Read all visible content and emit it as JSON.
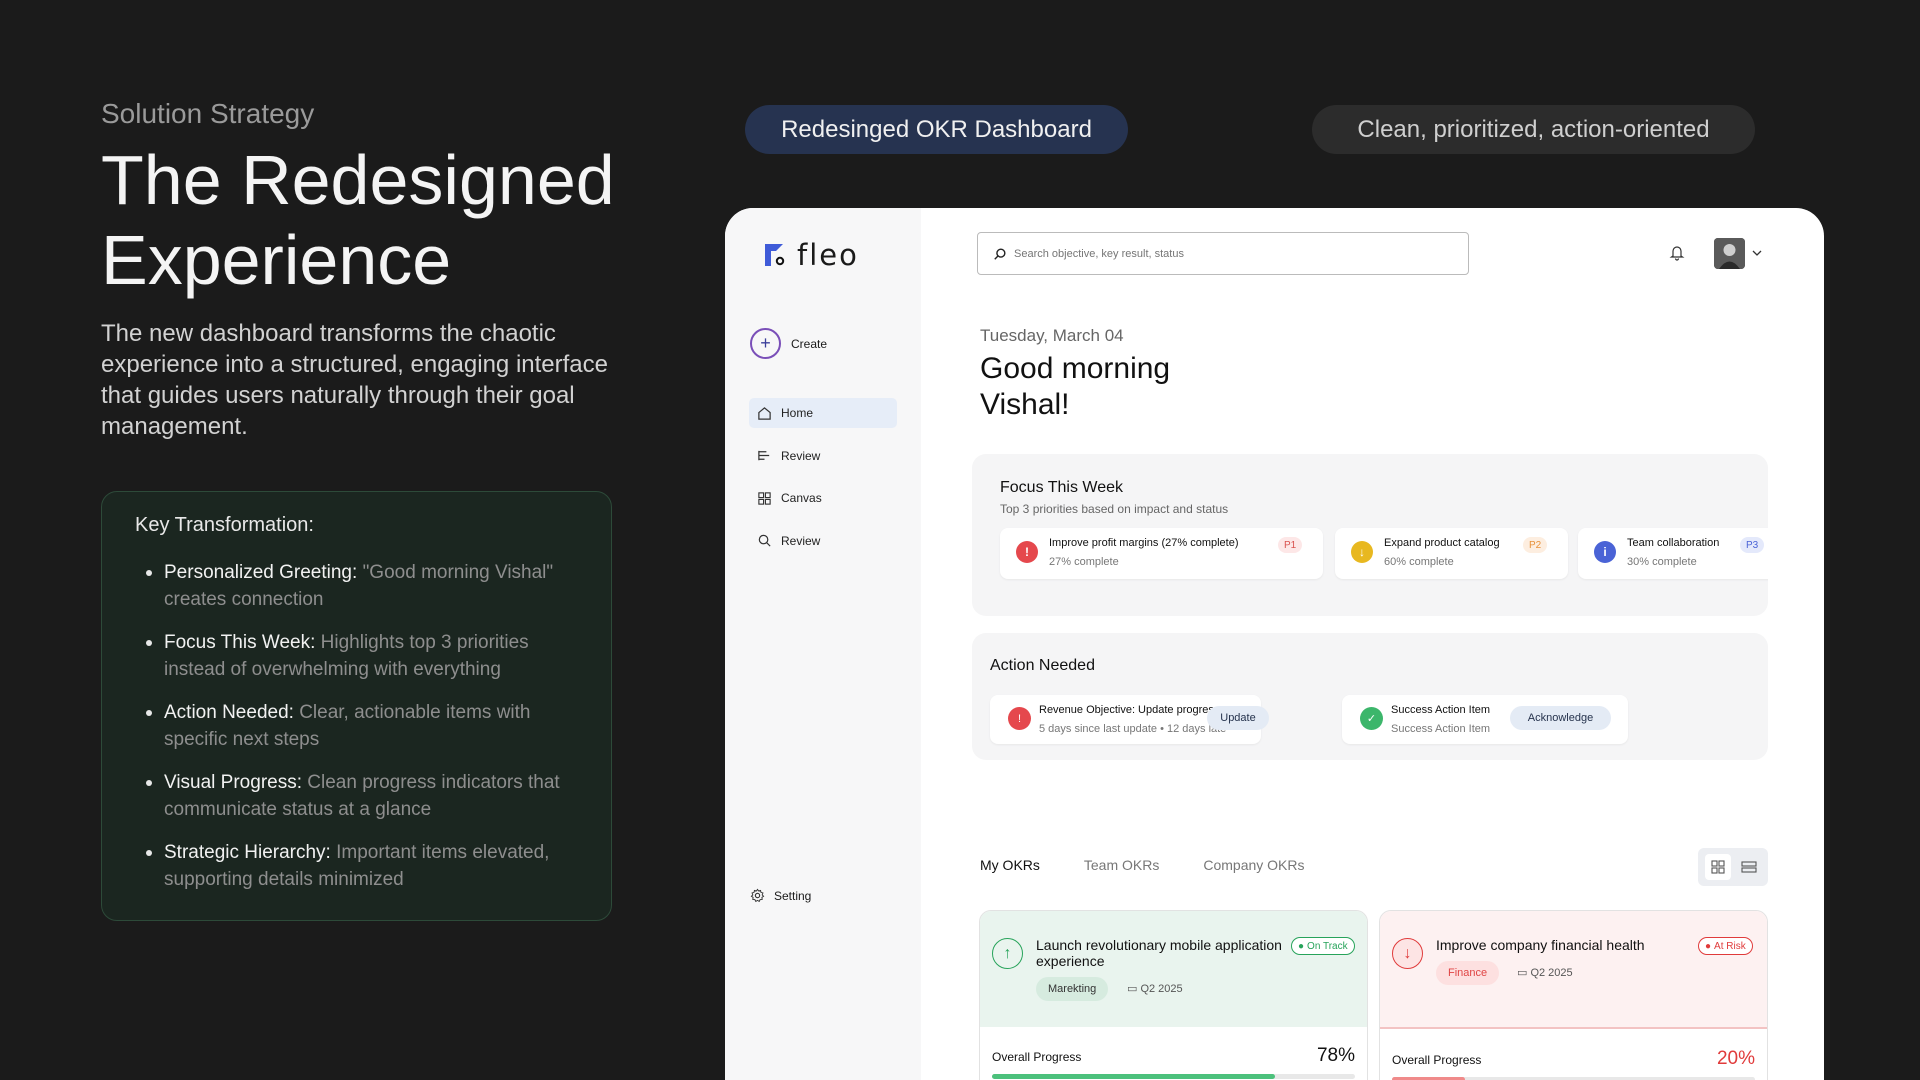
{
  "slide": {
    "eyebrow": "Solution Strategy",
    "headline": "The Redesigned Experience",
    "lede": "The new dashboard transforms the chaotic experience into a structured, engaging interface that guides users naturally through their goal management.",
    "key_box": {
      "title": "Key Transformation:",
      "items": [
        {
          "term": "Personalized Greeting:",
          "desc": "\"Good morning Vishal\" creates connection"
        },
        {
          "term": "Focus This Week:",
          "desc": "Highlights top 3 priorities instead of overwhelming with everything"
        },
        {
          "term": "Action Needed:",
          "desc": "Clear, actionable items with specific next steps"
        },
        {
          "term": "Visual Progress:",
          "desc": "Clean progress indicators that communicate status at a glance"
        },
        {
          "term": "Strategic Hierarchy:",
          "desc": "Important items elevated, supporting details minimized"
        }
      ]
    },
    "pill_left": "Redesinged OKR Dashboard",
    "pill_right": "Clean, prioritized, action-oriented"
  },
  "app": {
    "logo": "fleo",
    "create_label": "Create",
    "nav": [
      {
        "label": "Home",
        "icon": "home-icon",
        "active": true
      },
      {
        "label": "Review",
        "icon": "review-icon",
        "active": false
      },
      {
        "label": "Canvas",
        "icon": "canvas-icon",
        "active": false
      },
      {
        "label": "Review",
        "icon": "search-icon",
        "active": false
      }
    ],
    "setting_label": "Setting",
    "search_placeholder": "Search objective, key result, status",
    "date": "Tuesday, March 04",
    "greeting": "Good morning Vishal!",
    "focus": {
      "title": "Focus This Week",
      "subtitle": "Top 3 priorities based on impact and status",
      "cards": [
        {
          "title": "Improve profit margins (27% complete)",
          "sub": "27% complete",
          "priority": "P1",
          "icon_color": "#e5484d",
          "badge_bg": "#fde7e7",
          "badge_color": "#d9534f"
        },
        {
          "title": "Expand product catalog",
          "sub": "60% complete",
          "priority": "P2",
          "icon_color": "#e8b820",
          "badge_bg": "#fdeee0",
          "badge_color": "#e8923a"
        },
        {
          "title": "Team collaboration",
          "sub": "30% complete",
          "priority": "P3",
          "icon_color": "#4a63d6",
          "badge_bg": "#e4e9fb",
          "badge_color": "#4a63d6"
        }
      ]
    },
    "action": {
      "title": "Action Needed",
      "items": [
        {
          "title": "Revenue Objective: Update progress",
          "sub": "5 days since last update • 12 days late",
          "button": "Update",
          "icon_color": "#e5484d"
        },
        {
          "title": "Success Action Item",
          "sub": "Success Action Item",
          "button": "Acknowledge",
          "icon_color": "#3cb66b"
        }
      ]
    },
    "tabs": [
      "My OKRs",
      "Team OKRs",
      "Company OKRs"
    ],
    "okrs": [
      {
        "title": "Launch revolutionary mobile application experience",
        "status": "On Track",
        "tag": "Marekting",
        "quarter": "Q2 2025",
        "progress_label": "Overall Progress",
        "progress_text": "78%",
        "progress": 78,
        "accent": "#27a35a",
        "tint": "#e9f4ee",
        "tag_bg": "#d6ebdf",
        "tag_color": "#333"
      },
      {
        "title": "Improve company financial health",
        "status": "At Risk",
        "tag": "Finance",
        "quarter": "Q2 2025",
        "progress_label": "Overall Progress",
        "progress_text": "20%",
        "progress": 20,
        "accent": "#e03b3b",
        "tint": "#fdf1f1",
        "tag_bg": "#fde0e0",
        "tag_color": "#e04545"
      }
    ]
  }
}
